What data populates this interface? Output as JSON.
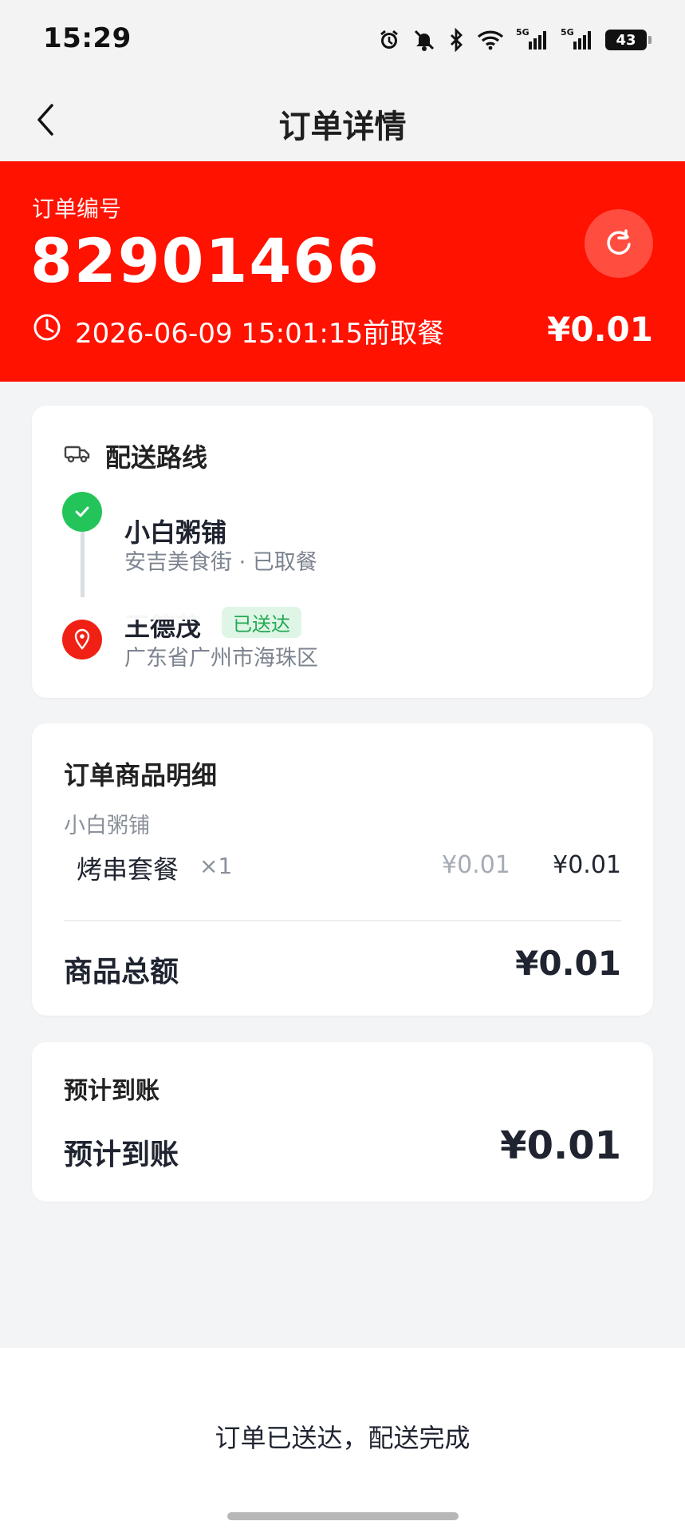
{
  "status_bar": {
    "time": "15:29",
    "network": "5G",
    "battery": "43"
  },
  "nav": {
    "title": "订单详情"
  },
  "order": {
    "label": "订单编号",
    "number": "82901466",
    "pickup_time": "2026-06-09 15:01:15前取餐",
    "amount": "¥0.01"
  },
  "route": {
    "title": "配送路线",
    "stops": [
      {
        "name": "小白粥铺",
        "detail": "安吉美食街 · 已取餐"
      },
      {
        "name": "王德茂",
        "detail": "广东省广州市海珠区",
        "badge": "已送达"
      }
    ]
  },
  "items": {
    "title": "订单商品明细",
    "store": "小白粥铺",
    "rows": [
      {
        "name": "烤串套餐",
        "qty": "×1",
        "unit_price": "¥0.01",
        "total": "¥0.01"
      }
    ],
    "total_label": "商品总额",
    "total_value": "¥0.01"
  },
  "income": {
    "title": "预计到账",
    "label": "预计到账",
    "value": "¥0.01"
  },
  "bottom": {
    "message": "订单已送达，配送完成"
  },
  "colors": {
    "header_bg": "#ff1200",
    "success_green": "#23c45a",
    "location_red": "#f02114"
  }
}
